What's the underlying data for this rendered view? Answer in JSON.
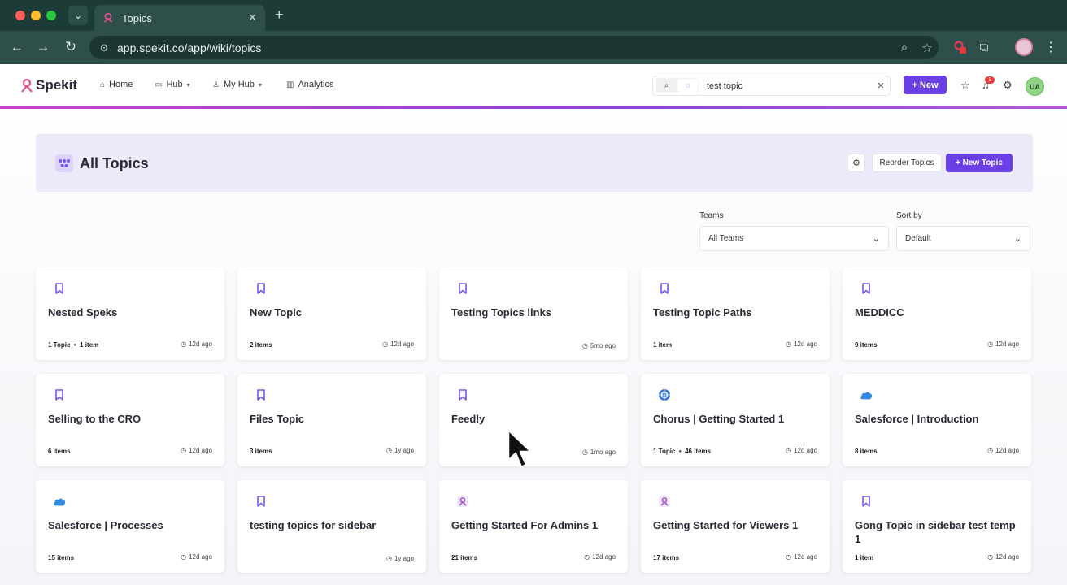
{
  "browser": {
    "tab_title": "Topics",
    "url": "app.spekit.co/app/wiki/topics"
  },
  "app": {
    "logo_text": "Spekit",
    "nav": [
      {
        "label": "Home"
      },
      {
        "label": "Hub"
      },
      {
        "label": "My Hub"
      },
      {
        "label": "Analytics"
      }
    ],
    "search_value": "test topic",
    "new_label": "+ New",
    "notification_count": "1",
    "avatar_initials": "UA",
    "accent_color": "#6b3fe6"
  },
  "header": {
    "title": "All Topics",
    "reorder_label": "Reorder Topics",
    "new_topic_label": "+ New Topic"
  },
  "filters": {
    "teams_label": "Teams",
    "teams_value": "All Teams",
    "sort_label": "Sort by",
    "sort_value": "Default"
  },
  "cards": [
    {
      "title": "Nested Speks",
      "meta": "1 Topic  •  1 item",
      "time": "12d ago",
      "icon": "bookmark-icon"
    },
    {
      "title": "New Topic",
      "meta": "2 items",
      "time": "12d ago",
      "icon": "bookmark-icon"
    },
    {
      "title": "Testing Topics links",
      "meta": "",
      "time": "5mo ago",
      "icon": "bookmark-icon"
    },
    {
      "title": "Testing Topic Paths",
      "meta": "1 item",
      "time": "12d ago",
      "icon": "bookmark-icon"
    },
    {
      "title": "MEDDICC",
      "meta": "9 items",
      "time": "12d ago",
      "icon": "bookmark-icon"
    },
    {
      "title": "Selling to the CRO",
      "meta": "6 items",
      "time": "12d ago",
      "icon": "bookmark-icon"
    },
    {
      "title": "Files Topic",
      "meta": "3 items",
      "time": "1y ago",
      "icon": "bookmark-icon"
    },
    {
      "title": "Feedly",
      "meta": "",
      "time": "1mo ago",
      "icon": "bookmark-icon"
    },
    {
      "title": "Chorus | Getting Started 1",
      "meta": "1 Topic  •  46 items",
      "time": "12d ago",
      "icon": "chorus-icon"
    },
    {
      "title": "Salesforce | Introduction",
      "meta": "8 items",
      "time": "12d ago",
      "icon": "salesforce-cloud-icon"
    },
    {
      "title": "Salesforce | Processes",
      "meta": "15 items",
      "time": "12d ago",
      "icon": "salesforce-cloud-icon"
    },
    {
      "title": "testing topics for sidebar",
      "meta": "",
      "time": "1y ago",
      "icon": "bookmark-icon"
    },
    {
      "title": "Getting Started For Admins 1",
      "meta": "21 items",
      "time": "12d ago",
      "icon": "spekit-icon"
    },
    {
      "title": "Getting Started for Viewers 1",
      "meta": "17 items",
      "time": "12d ago",
      "icon": "spekit-icon"
    },
    {
      "title": "Gong Topic in sidebar test temp 1",
      "meta": "1 item",
      "time": "12d ago",
      "icon": "bookmark-icon"
    }
  ]
}
